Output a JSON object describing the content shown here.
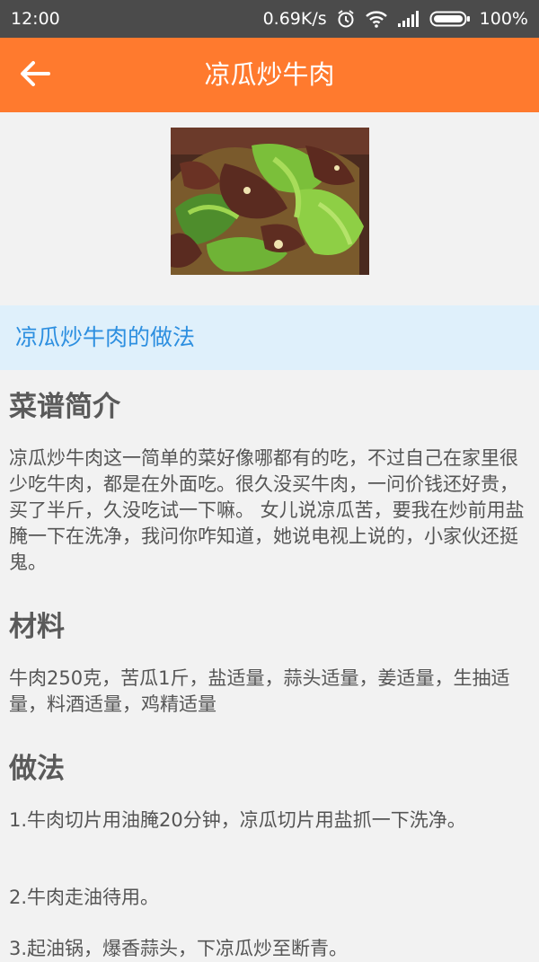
{
  "status_bar": {
    "time": "12:00",
    "speed": "0.69K/s",
    "battery": "100%",
    "icons": [
      "alarm-icon",
      "wifi-icon",
      "signal-icon",
      "battery-icon"
    ]
  },
  "app_bar": {
    "title": "凉瓜炒牛肉",
    "back_icon": "back-arrow-icon",
    "color": "#ff7a2e"
  },
  "recipe": {
    "image": "dish-photo",
    "section_title": "凉瓜炒牛肉的做法",
    "intro_heading": "菜谱简介",
    "intro_text": "凉瓜炒牛肉这一简单的菜好像哪都有的吃，不过自己在家里很少吃牛肉，都是在外面吃。很久没买牛肉，一问价钱还好贵，买了半斤，久没吃试一下嘛。 女儿说凉瓜苦，要我在炒前用盐腌一下在洗净，我问你咋知道，她说电视上说的，小家伙还挺鬼。",
    "materials_heading": "材料",
    "materials_text": "牛肉250克，苦瓜1斤，盐适量，蒜头适量，姜适量，生抽适量，料酒适量，鸡精适量",
    "method_heading": "做法",
    "steps": [
      "1.牛肉切片用油腌20分钟，凉瓜切片用盐抓一下洗净。",
      "2.牛肉走油待用。",
      "3.起油锅，爆香蒜头，下凉瓜炒至断青。"
    ]
  }
}
